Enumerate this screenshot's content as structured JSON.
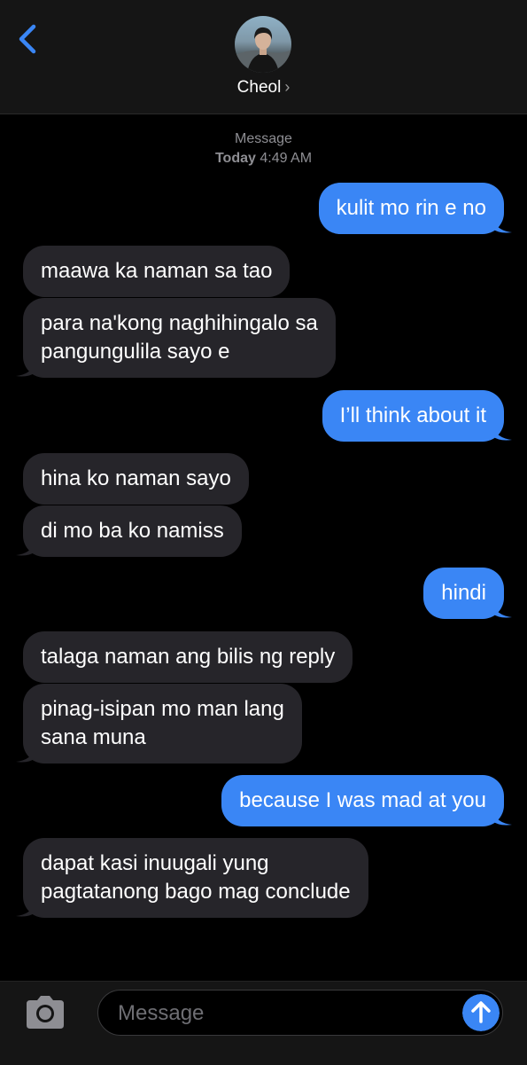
{
  "header": {
    "back_icon": "chevron-left-icon",
    "contact_name": "Cheol",
    "contact_chevron": "›",
    "accent_color": "#3a86f5"
  },
  "thread_meta": {
    "service": "Message",
    "day": "Today",
    "time": "4:49 AM"
  },
  "messages": [
    {
      "side": "out",
      "text": "kulit mo rin e no"
    },
    {
      "side": "in",
      "text": "maawa ka naman sa tao"
    },
    {
      "side": "in",
      "lines": [
        "para na'kong naghihingalo sa",
        "pangungulila sayo e"
      ]
    },
    {
      "side": "out",
      "text": "I’ll think about it"
    },
    {
      "side": "in",
      "text": "hina ko naman sayo"
    },
    {
      "side": "in",
      "text": "di mo ba ko namiss"
    },
    {
      "side": "out",
      "text": "hindi"
    },
    {
      "side": "in",
      "text": "talaga naman ang bilis ng reply"
    },
    {
      "side": "in",
      "lines": [
        "pinag-isipan mo man lang",
        "sana muna"
      ]
    },
    {
      "side": "out",
      "text": "because I was mad at you"
    },
    {
      "side": "in",
      "lines": [
        "dapat kasi inuugali yung",
        "pagtatanong bago mag conclude"
      ]
    }
  ],
  "composer": {
    "camera_icon": "camera-icon",
    "placeholder": "Message",
    "value": "",
    "send_icon": "arrow-up-icon"
  }
}
